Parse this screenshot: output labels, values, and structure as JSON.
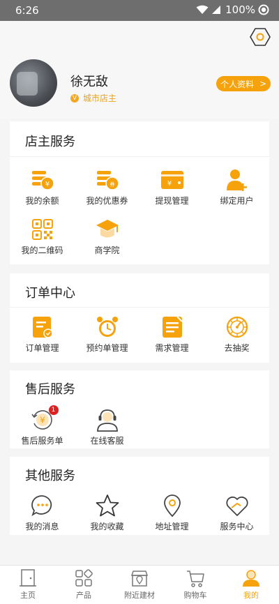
{
  "status_bar": {
    "time": "6:26",
    "battery": "100%"
  },
  "profile": {
    "name": "徐无敌",
    "role_badge": "V",
    "role": "城市店主",
    "profile_button": "个人资料",
    "profile_arrow": ">"
  },
  "colors": {
    "accent": "#f5a20c",
    "bg": "#f5f5f5"
  },
  "sections": {
    "shop_services": {
      "title": "店主服务",
      "items": [
        {
          "label": "我的余额",
          "icon": "balance-icon"
        },
        {
          "label": "我的优惠券",
          "icon": "coupon-icon"
        },
        {
          "label": "提现管理",
          "icon": "withdraw-icon"
        },
        {
          "label": "绑定用户",
          "icon": "bind-user-icon"
        },
        {
          "label": "我的二维码",
          "icon": "qr-code-icon"
        },
        {
          "label": "商学院",
          "icon": "graduation-cap-icon"
        }
      ]
    },
    "order_center": {
      "title": "订单中心",
      "items": [
        {
          "label": "订单管理",
          "icon": "order-icon"
        },
        {
          "label": "预约单管理",
          "icon": "alarm-clock-icon"
        },
        {
          "label": "需求管理",
          "icon": "demand-icon"
        },
        {
          "label": "去抽奖",
          "icon": "lottery-wheel-icon"
        }
      ]
    },
    "after_sales": {
      "title": "售后服务",
      "items": [
        {
          "label": "售后服务单",
          "icon": "refund-icon",
          "badge": "1"
        },
        {
          "label": "在线客服",
          "icon": "customer-service-icon"
        }
      ]
    },
    "other_services": {
      "title": "其他服务",
      "items": [
        {
          "label": "我的消息",
          "icon": "message-icon"
        },
        {
          "label": "我的收藏",
          "icon": "star-icon"
        },
        {
          "label": "地址管理",
          "icon": "location-pin-icon"
        },
        {
          "label": "服务中心",
          "icon": "heart-icon"
        }
      ]
    }
  },
  "tabs": [
    {
      "label": "主页",
      "icon": "door-icon"
    },
    {
      "label": "产品",
      "icon": "grid-icon"
    },
    {
      "label": "附近建材",
      "icon": "store-icon"
    },
    {
      "label": "购物车",
      "icon": "cart-icon"
    },
    {
      "label": "我的",
      "icon": "user-icon",
      "active": true
    }
  ]
}
